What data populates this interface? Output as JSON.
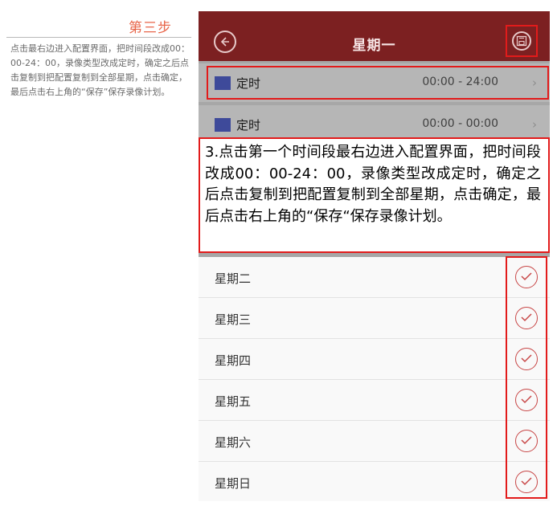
{
  "guide": {
    "step_title": "第三步",
    "step_text": "点击最右边进入配置界面，把时间段改成00：00-24：00，录像类型改成定时，确定之后点击复制到把配置复制到全部星期，点击确定，最后点击右上角的“保存”保存录像计划。"
  },
  "header": {
    "title": "星期一",
    "back_icon": "back-arrow-icon",
    "save_icon": "save-icon"
  },
  "time_slots": [
    {
      "type_label": "定时",
      "range": "00:00 - 24:00",
      "swatch_color": "#3e4a9a",
      "arrow": "›"
    },
    {
      "type_label": "定时",
      "range": "00:00 - 00:00",
      "swatch_color": "#3e4a9a",
      "arrow": "›"
    }
  ],
  "annotation": {
    "text": "3.点击第一个时间段最右边进入配置界面，把时间段改成00：00-24：00，录像类型改成定时，确定之后点击复制到把配置复制到全部星期，点击确定，最后点击右上角的“保存“保存录像计划。"
  },
  "days": [
    {
      "label": "星期二",
      "checked": false
    },
    {
      "label": "星期三",
      "checked": false
    },
    {
      "label": "星期四",
      "checked": false
    },
    {
      "label": "星期五",
      "checked": false
    },
    {
      "label": "星期六",
      "checked": false
    },
    {
      "label": "星期日",
      "checked": false
    }
  ],
  "colors": {
    "header_bg": "#7c2021",
    "highlight": "#e21b1b",
    "step_title": "#e8664a",
    "check": "#c84747"
  }
}
